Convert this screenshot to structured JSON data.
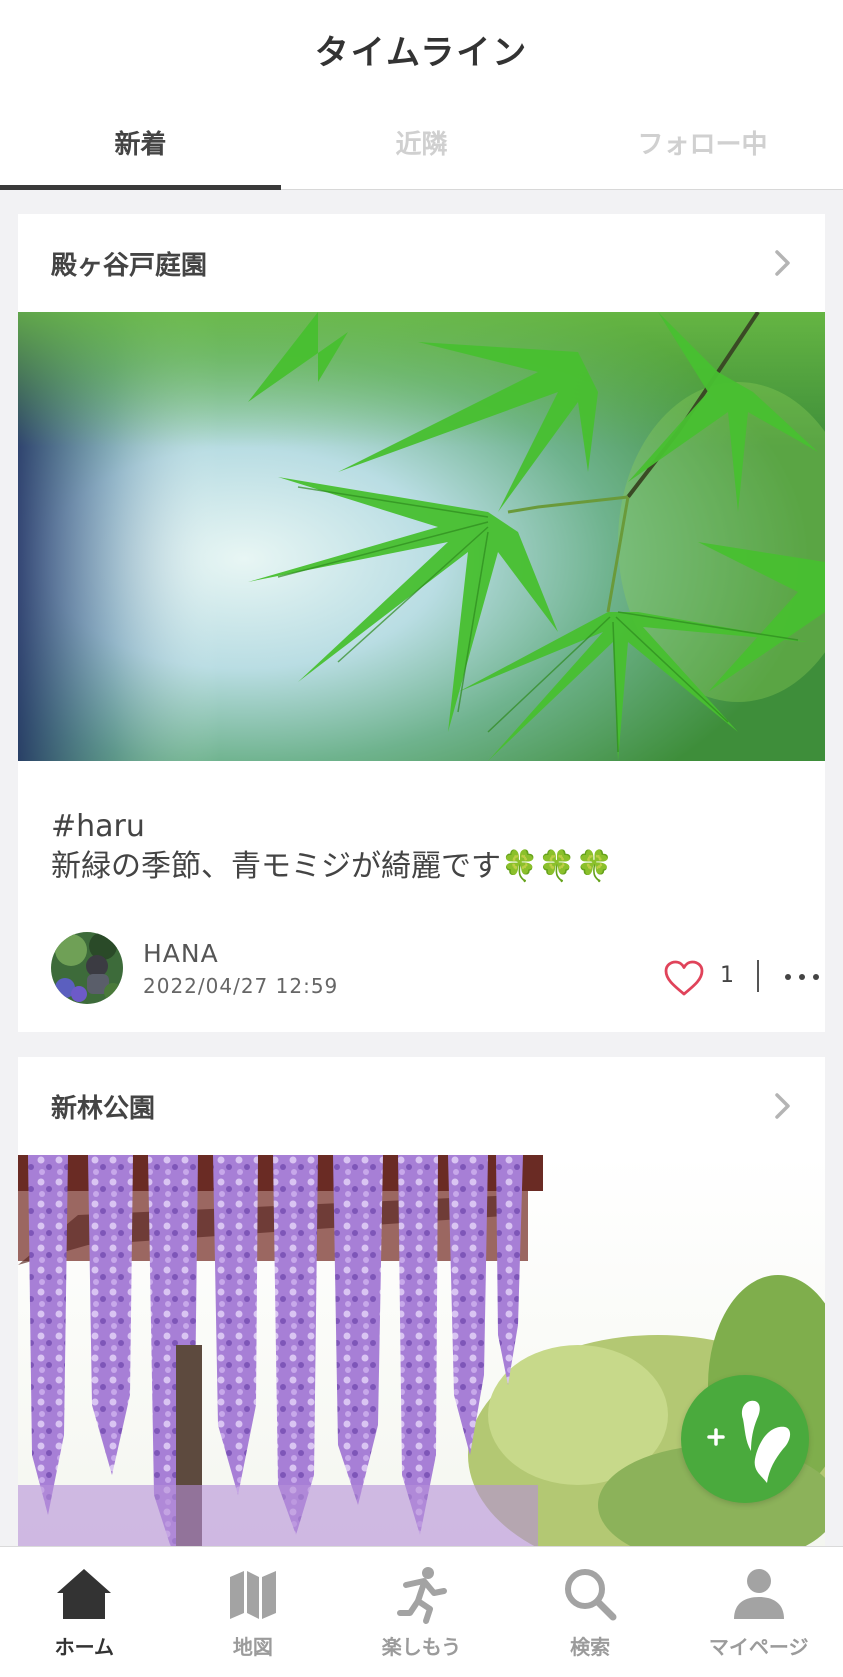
{
  "header": {
    "title": "タイムライン"
  },
  "tabs": [
    {
      "label": "新着",
      "active": true
    },
    {
      "label": "近隣",
      "active": false
    },
    {
      "label": "フォロー中",
      "active": false
    }
  ],
  "posts": [
    {
      "place": "殿ヶ谷戸庭園",
      "photo_icon": "maple-leaves-photo",
      "hashtag": "#haru",
      "caption": "新緑の季節、青モミジが綺麗です🍀🍀🍀",
      "user": "HANA",
      "date": "2022/04/27 12:59",
      "likes": "1"
    },
    {
      "place": "新林公園",
      "photo_icon": "wisteria-photo"
    }
  ],
  "fab": {
    "icon": "add-post-icon"
  },
  "bottom_nav": [
    {
      "label": "ホーム",
      "icon": "home-icon",
      "active": true
    },
    {
      "label": "地図",
      "icon": "map-icon",
      "active": false
    },
    {
      "label": "楽しもう",
      "icon": "running-person-icon",
      "active": false
    },
    {
      "label": "検索",
      "icon": "search-icon",
      "active": false
    },
    {
      "label": "マイページ",
      "icon": "person-icon",
      "active": false
    }
  ],
  "colors": {
    "accent_green": "#4aaa3d",
    "like_red": "#e0435a",
    "active_tab": "#3a3a3a",
    "inactive": "#9b9b9b"
  }
}
